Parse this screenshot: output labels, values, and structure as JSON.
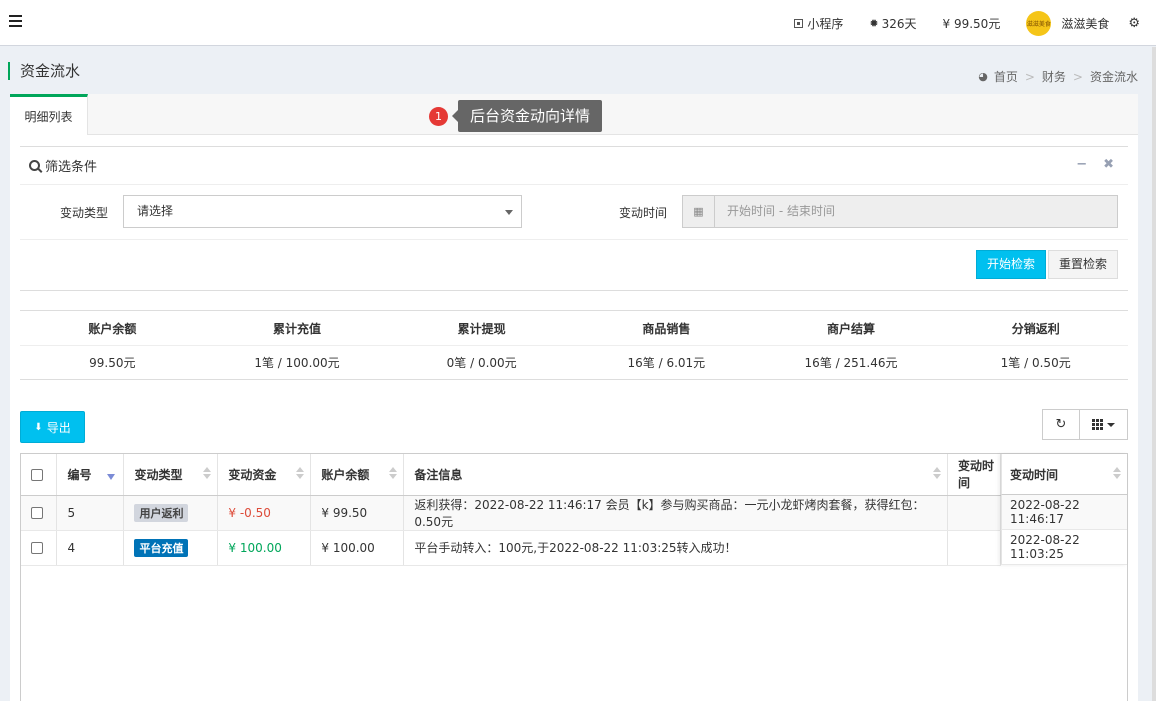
{
  "topbar": {
    "items": [
      {
        "icon": "qr-code-icon",
        "label": "小程序"
      },
      {
        "icon": "circle-icon",
        "label": "326天"
      },
      {
        "icon": "",
        "label": "¥ 99.50元"
      }
    ],
    "user": {
      "name": "滋滋美食",
      "avatar_text": "滋滋美食"
    }
  },
  "page": {
    "title": "资金流水",
    "breadcrumb": [
      "首页",
      "财务",
      "资金流水"
    ]
  },
  "tabs": [
    {
      "label": "明细列表"
    }
  ],
  "tooltip": {
    "number": "1",
    "text": "后台资金动向详情"
  },
  "filter": {
    "title": "筛选条件",
    "type_label": "变动类型",
    "type_value": "请选择",
    "time_label": "变动时间",
    "time_placeholder": "开始时间 - 结束时间",
    "search_button": "开始检索",
    "reset_button": "重置检索"
  },
  "stats": {
    "headers": [
      "账户余额",
      "累计充值",
      "累计提现",
      "商品销售",
      "商户结算",
      "分销返利"
    ],
    "values": [
      "99.50元",
      "1笔 / 100.00元",
      "0笔 / 0.00元",
      "16笔 / 6.01元",
      "16笔 / 251.46元",
      "1笔 / 0.50元"
    ]
  },
  "toolbar": {
    "export_label": "导出"
  },
  "table": {
    "columns": [
      "编号",
      "变动类型",
      "变动资金",
      "账户余额",
      "备注信息",
      "变动时间"
    ],
    "fixed_header": "变动时间",
    "rows": [
      {
        "id": "5",
        "type": "用户返利",
        "type_style": "gray",
        "amount": "¥ -0.50",
        "amount_sign": "neg",
        "balance": "¥ 99.50",
        "remark": "返利获得：2022-08-22 11:46:17 会员【k】参与购买商品：一元小龙虾烤肉套餐，获得红包：0.50元",
        "time": "2022-08-22 11:46:17"
      },
      {
        "id": "4",
        "type": "平台充值",
        "type_style": "blue",
        "amount": "¥ 100.00",
        "amount_sign": "pos",
        "balance": "¥ 100.00",
        "remark": "平台手动转入：100元,于2022-08-22 11:03:25转入成功！",
        "time": "2022-08-22 11:03:25"
      }
    ]
  }
}
